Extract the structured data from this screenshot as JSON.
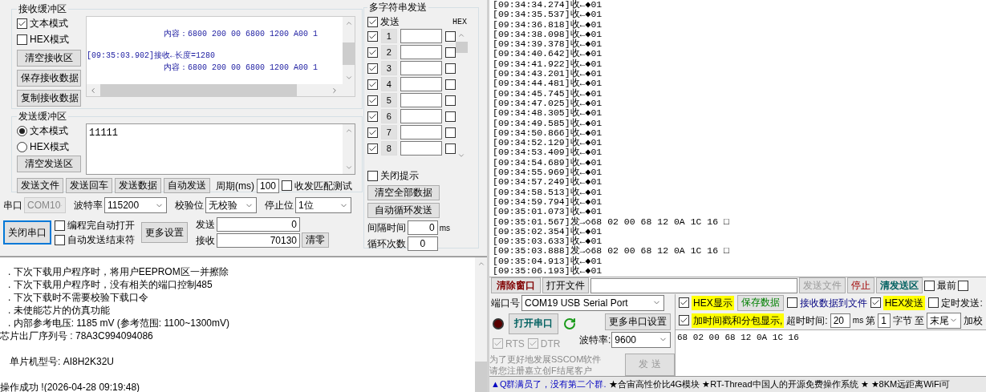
{
  "receive_buffer": {
    "title": "接收缓冲区",
    "modes": [
      {
        "label": "文本模式",
        "checked": true
      },
      {
        "label": "HEX模式",
        "checked": false
      }
    ],
    "buttons": [
      "清空接收区",
      "保存接收数据",
      "复制接收数据"
    ],
    "lines": [
      {
        "kind": "content",
        "text": "内容：6800 200 00 6800 1200 A00 1"
      },
      {
        "kind": "header",
        "text": "[09:35:03.902]接收←长度=1280"
      },
      {
        "kind": "content",
        "text": "内容：6800 200 00 6800 1200 A00 1"
      }
    ]
  },
  "send_buffer": {
    "title": "发送缓冲区",
    "modes": [
      {
        "label": "文本模式",
        "selected": true
      },
      {
        "label": "HEX模式",
        "selected": false
      }
    ],
    "clear_button": "清空发送区",
    "value": "11111",
    "buttons": [
      "发送文件",
      "发送回车",
      "发送数据",
      "自动发送"
    ],
    "period_label": "周期(ms)",
    "period": "100",
    "match_test": {
      "label": "收发匹配测试",
      "checked": false
    }
  },
  "port_settings": [
    {
      "label": "串口",
      "value": "COM10",
      "disabled": true
    },
    {
      "label": "波特率",
      "value": "115200",
      "disabled": false
    },
    {
      "label": "校验位",
      "value": "无校验",
      "disabled": false
    },
    {
      "label": "停止位",
      "value": "1位",
      "disabled": false
    }
  ],
  "close_port_button": "关闭串口",
  "options": [
    {
      "label": "编程完自动打开",
      "checked": false
    },
    {
      "label": "自动发送结束符",
      "checked": false
    }
  ],
  "more_button": "更多设置",
  "counters": [
    {
      "label": "发送",
      "value": "0"
    },
    {
      "label": "接收",
      "value": "70130"
    }
  ],
  "clear_counters_button": "清零",
  "multi_send": {
    "title": "多字符串发送",
    "send_all": {
      "label": "发送",
      "checked": true
    },
    "hex_header": "HEX",
    "rows": [
      {
        "label": "1",
        "checked": true,
        "hex": false
      },
      {
        "label": "2",
        "checked": true,
        "hex": false
      },
      {
        "label": "3",
        "checked": true,
        "hex": false
      },
      {
        "label": "4",
        "checked": true,
        "hex": false
      },
      {
        "label": "5",
        "checked": true,
        "hex": false
      },
      {
        "label": "6",
        "checked": true,
        "hex": false
      },
      {
        "label": "7",
        "checked": true,
        "hex": false
      },
      {
        "label": "8",
        "checked": true,
        "hex": false
      }
    ],
    "close_tip": {
      "label": "关闭提示",
      "checked": false
    },
    "buttons": [
      "清空全部数据",
      "自动循环发送"
    ],
    "interval": {
      "label": "间隔时间",
      "value": "0",
      "unit": "ms"
    },
    "loop": {
      "label": "循环次数",
      "value": "0"
    }
  },
  "program_log": [
    {
      "kind": "item",
      "text": ".  下次下载用户程序时，将用户EEPROM区一并擦除"
    },
    {
      "kind": "item",
      "text": ".  下次下载用户程序时，没有相关的端口控制485"
    },
    {
      "kind": "item",
      "text": ".  下次下载时不需要校验下载口令"
    },
    {
      "kind": "item",
      "text": ".  未使能芯片的仿真功能"
    },
    {
      "kind": "item",
      "text": ".  内部参考电压: 1185 mV (参考范围: 1100~1300mV)"
    },
    {
      "kind": "plain",
      "text": "芯片出厂序列号 : 78A3C994094086"
    },
    {
      "kind": "blank"
    },
    {
      "kind": "indented",
      "text": "单片机型号: AI8H2K32U"
    },
    {
      "kind": "blank"
    },
    {
      "kind": "plain",
      "text": "操作成功 !(2026-04-28 09:19:48)"
    }
  ],
  "serial_log": [
    "[09:34:34.274]收←◆01",
    "[09:34:35.537]收←◆01",
    "[09:34:36.818]收←◆01",
    "[09:34:38.098]收←◆01",
    "[09:34:39.378]收←◆01",
    "[09:34:40.642]收←◆01",
    "[09:34:41.922]收←◆01",
    "[09:34:43.201]收←◆01",
    "[09:34:44.481]收←◆01",
    "[09:34:45.745]收←◆01",
    "[09:34:47.025]收←◆01",
    "[09:34:48.305]收←◆01",
    "[09:34:49.585]收←◆01",
    "[09:34:50.866]收←◆01",
    "[09:34:52.129]收←◆01",
    "[09:34:53.409]收←◆01",
    "[09:34:54.689]收←◆01",
    "[09:34:55.969]收←◆01",
    "[09:34:57.249]收←◆01",
    "[09:34:58.513]收←◆01",
    "[09:34:59.794]收←◆01",
    "[09:35:01.073]收←◆01",
    "[09:35:01.567]发→◇68 02 00 68 12 0A 1C 16 □",
    "[09:35:02.354]收←◆01",
    "[09:35:03.633]收←◆01",
    "[09:35:03.888]发→◇68 02 00 68 12 0A 1C 16 □",
    "[09:35:04.913]收←◆01",
    "[09:35:06.193]收←◆01"
  ],
  "toolbar": {
    "clear_window": "清除窗口",
    "open_file": "打开文件",
    "send_file": {
      "label": "发送文件",
      "disabled": true
    },
    "stop": "停止",
    "clear_send": "清发送区",
    "topmost": {
      "label": "最前",
      "checked": false
    },
    "extra_checked": false
  },
  "port_panel": {
    "port_label": "端口号",
    "port": "COM19 USB Serial Port",
    "open_port": "打开串口",
    "more_settings": "更多串口设置",
    "signals": [
      {
        "label": "RTS",
        "checked": true
      },
      {
        "label": "DTR",
        "checked": true
      }
    ],
    "baud_label": "波特率:",
    "baud": "9600",
    "promo": [
      "为了更好地发展SSCOM软件",
      "请您注册嘉立创F结尾客户"
    ],
    "send": {
      "label": "发  送",
      "disabled": true
    }
  },
  "display_options": {
    "hex_display": {
      "label": "HEX显示",
      "checked": true
    },
    "save_data": "保存数据",
    "recv_to_file": {
      "label": "接收数据到文件",
      "checked": false
    },
    "hex_send": {
      "label": "HEX发送",
      "checked": true
    },
    "timed_send": {
      "label": "定时发送:",
      "checked": false
    },
    "timestamp": {
      "label": "加时间戳和分包显示,",
      "checked": true
    },
    "timeout_label": "超时时间:",
    "timeout": "20",
    "timeout_unit": "ms",
    "byte_from_label": "第",
    "byte_from": "1",
    "byte_unit": "字节",
    "to_label": "至",
    "byte_to": "末尾",
    "checksum_label": "加校"
  },
  "send_text": "68 02 00 68 12 0A 1C 16",
  "status_bar": [
    {
      "kind": "notice",
      "text": "▲Q群满员了，没有第二个群."
    },
    {
      "kind": "ad",
      "text": "★合宙高性价比4G模块"
    },
    {
      "kind": "ad",
      "text": "★RT-Thread中国人的开源免费操作系统"
    },
    {
      "kind": "ad",
      "text": "★"
    },
    {
      "kind": "ad",
      "text": "★8KM远距离WiFi可"
    }
  ]
}
